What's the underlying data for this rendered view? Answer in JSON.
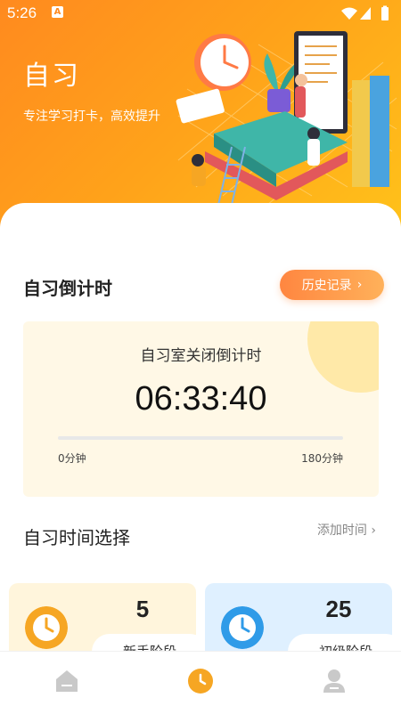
{
  "status_bar": {
    "time": "5:26",
    "notification_icon": "A"
  },
  "hero": {
    "title": "自习",
    "subtitle": "专注学习打卡，高效提升"
  },
  "countdown_section": {
    "title": "自习倒计时",
    "history_button": "历史记录",
    "card": {
      "label": "自习室关闭倒计时",
      "timer": "06:33:40",
      "progress_fraction": 0,
      "min_label": "0分钟",
      "max_label": "180分钟"
    }
  },
  "time_select": {
    "title": "自习时间选择",
    "add_time": "添加时间",
    "add_time_chevron": "›",
    "stages": [
      {
        "value": "5",
        "label": "新手阶段",
        "icon": "clock-icon",
        "color": "#f6a623"
      },
      {
        "value": "25",
        "label": "初级阶段",
        "icon": "clock-icon",
        "color": "#2f9be8"
      }
    ]
  },
  "tab_bar": {
    "items": [
      {
        "name": "home",
        "icon": "home-icon",
        "active": false
      },
      {
        "name": "study",
        "icon": "clock-icon",
        "active": true
      },
      {
        "name": "profile",
        "icon": "person-icon",
        "active": false
      }
    ],
    "active_color": "#f6a623",
    "inactive_color": "#c9c9c9"
  }
}
